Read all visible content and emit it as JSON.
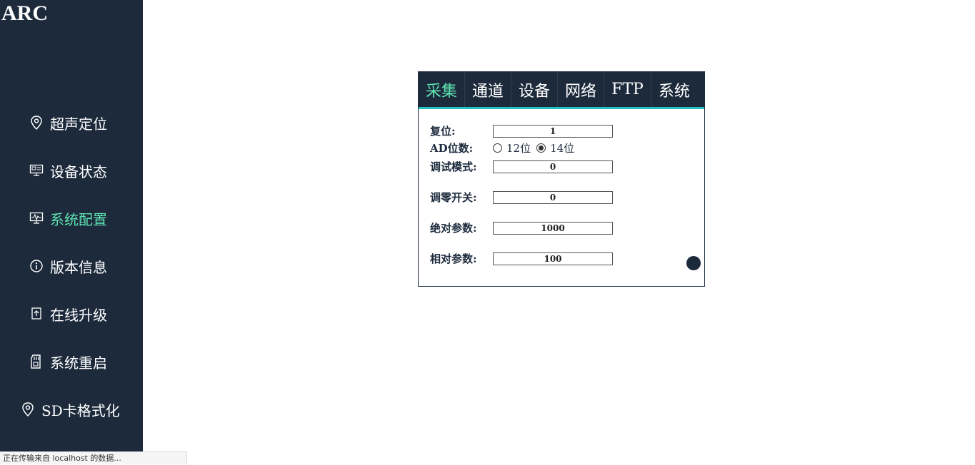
{
  "app": {
    "logo": "ARC"
  },
  "sidebar": {
    "items": [
      {
        "label": "超声定位",
        "icon": "location-pin-icon",
        "active": false
      },
      {
        "label": "设备状态",
        "icon": "monitor-icon",
        "active": false
      },
      {
        "label": "系统配置",
        "icon": "chart-monitor-icon",
        "active": true
      },
      {
        "label": "版本信息",
        "icon": "info-icon",
        "active": false
      },
      {
        "label": "在线升级",
        "icon": "upgrade-icon",
        "active": false
      },
      {
        "label": "系统重启",
        "icon": "sd-card-icon",
        "active": false
      },
      {
        "label": "SD卡格式化",
        "icon": "location-pin-icon",
        "active": false
      }
    ]
  },
  "panel": {
    "tabs": [
      "采集",
      "通道",
      "设备",
      "网络",
      "FTP",
      "系统"
    ],
    "active_tab": "采集",
    "fields": {
      "reset": {
        "label": "复位:",
        "value": "1"
      },
      "ad_bits": {
        "label": "AD位数:",
        "options": [
          "12位",
          "14位"
        ],
        "selected": "14位"
      },
      "debug_mode": {
        "label": "调试模式:",
        "value": "0"
      },
      "zero_switch": {
        "label": "调零开关:",
        "value": "0"
      },
      "absolute_param": {
        "label": "绝对参数:",
        "value": "1000"
      },
      "relative_param": {
        "label": "相对参数:",
        "value": "100"
      }
    }
  },
  "status_bar": {
    "text": "正在传输来自 localhost 的数据..."
  },
  "colors": {
    "sidebar_bg": "#1c2a3c",
    "accent": "#5fe3b1",
    "tab_underline": "#1fc2c2"
  }
}
